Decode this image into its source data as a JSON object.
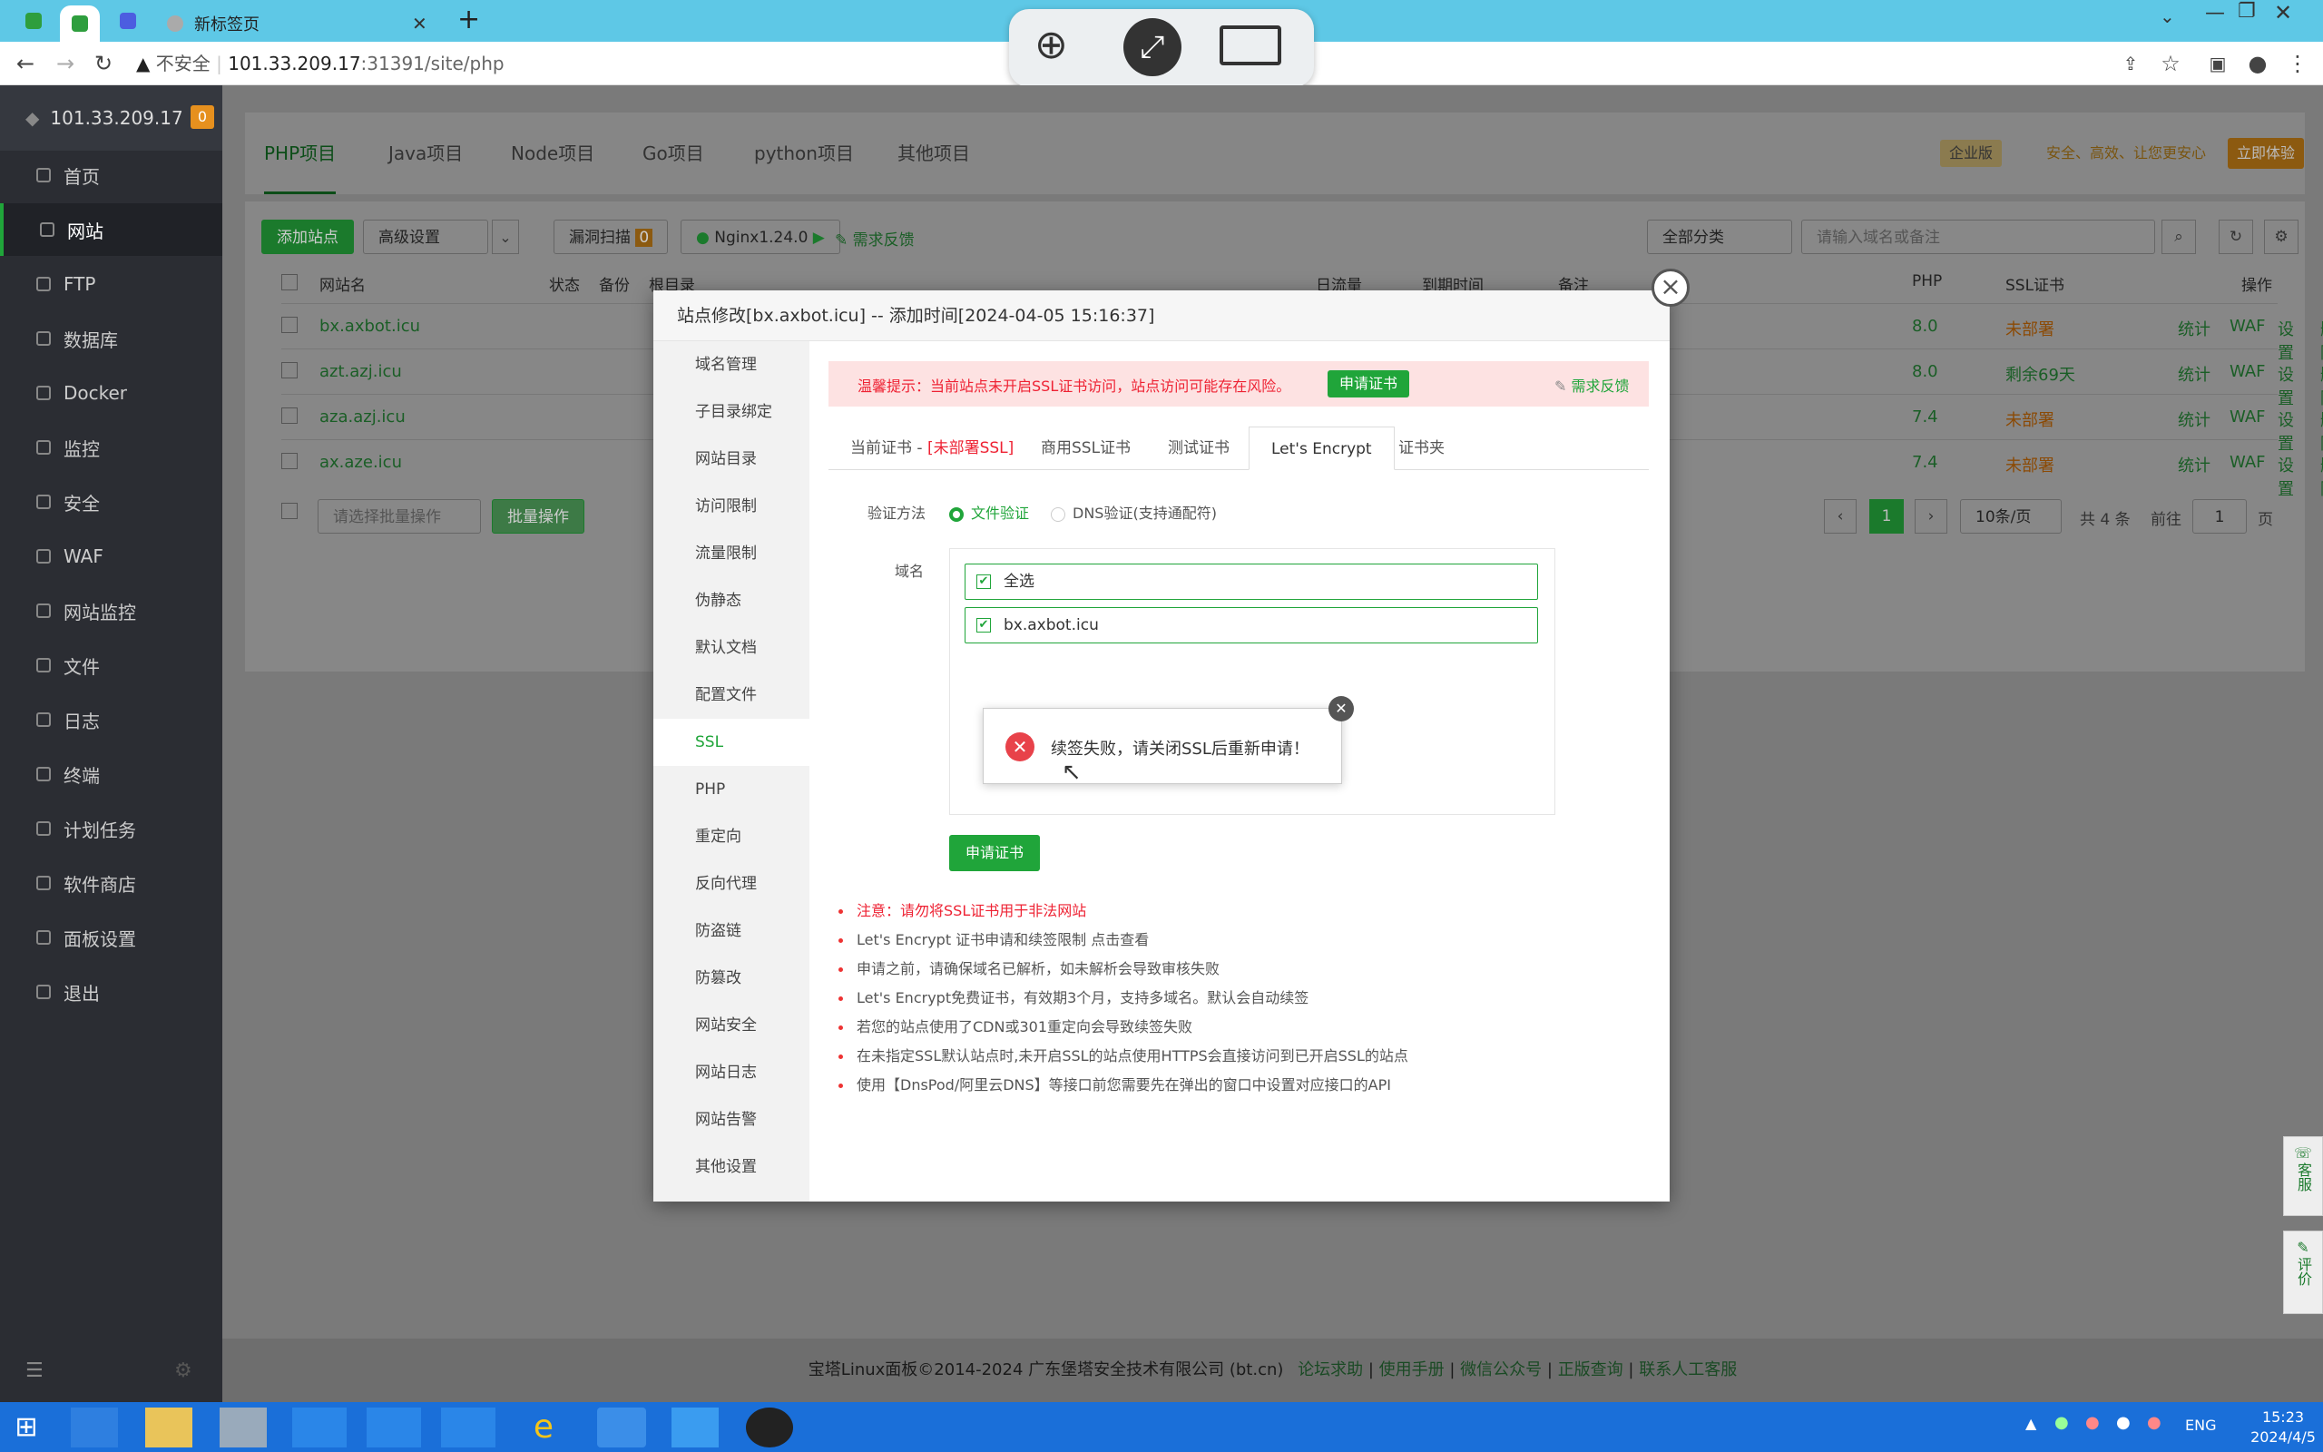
{
  "browser": {
    "tab_title": "新标签页",
    "new_tab_label": "+",
    "url_security": "不安全",
    "url_host": "101.33.209.17",
    "url_rest": ":31391/site/php"
  },
  "sidebar": {
    "host": "101.33.209.17",
    "badge": "0",
    "items": [
      {
        "label": "首页"
      },
      {
        "label": "网站"
      },
      {
        "label": "FTP"
      },
      {
        "label": "数据库"
      },
      {
        "label": "Docker"
      },
      {
        "label": "监控"
      },
      {
        "label": "安全"
      },
      {
        "label": "WAF"
      },
      {
        "label": "网站监控"
      },
      {
        "label": "文件"
      },
      {
        "label": "日志"
      },
      {
        "label": "终端"
      },
      {
        "label": "计划任务"
      },
      {
        "label": "软件商店"
      },
      {
        "label": "面板设置"
      },
      {
        "label": "退出"
      }
    ]
  },
  "topnav": {
    "tabs": [
      {
        "label": "PHP项目"
      },
      {
        "label": "Java项目"
      },
      {
        "label": "Node项目"
      },
      {
        "label": "Go项目"
      },
      {
        "label": "python项目"
      },
      {
        "label": "其他项目"
      }
    ],
    "enterprise_badge": "企业版",
    "promo": "安全、高效、让您更安心",
    "try_button": "立即体验"
  },
  "toolbar": {
    "add_site": "添加站点",
    "advanced": "高级设置",
    "scan": "漏洞扫描",
    "scan_count": "0",
    "nginx": "Nginx1.24.0",
    "feedback": "需求反馈",
    "category": "全部分类",
    "search_placeholder": "请输入域名或备注"
  },
  "table": {
    "headers": {
      "name": "网站名",
      "status": "状态",
      "backup": "备份",
      "root": "根目录",
      "traffic": "日流量",
      "expire": "到期时间",
      "note": "备注",
      "php": "PHP",
      "ssl": "SSL证书",
      "ops": "操作"
    },
    "rows": [
      {
        "name": "bx.axbot.icu",
        "php": "8.0",
        "ssl": "未部署"
      },
      {
        "name": "azt.azj.icu",
        "php": "8.0",
        "ssl": "剩余69天"
      },
      {
        "name": "aza.azj.icu",
        "php": "7.4",
        "ssl": "未部署"
      },
      {
        "name": "ax.aze.icu",
        "php": "7.4",
        "ssl": "未部署"
      }
    ],
    "row_ops": [
      "统计",
      "WAF",
      "设置",
      "删除"
    ],
    "batch_placeholder": "请选择批量操作",
    "batch_button": "批量操作",
    "page_current": "1",
    "page_size": "10条/页",
    "total": "共 4 条",
    "goto": "前往",
    "goto_value": "1",
    "page_unit": "页"
  },
  "modal": {
    "title": "站点修改[bx.axbot.icu] -- 添加时间[2024-04-05 15:16:37]",
    "menu": [
      {
        "label": "域名管理"
      },
      {
        "label": "子目录绑定"
      },
      {
        "label": "网站目录"
      },
      {
        "label": "访问限制"
      },
      {
        "label": "流量限制"
      },
      {
        "label": "伪静态"
      },
      {
        "label": "默认文档"
      },
      {
        "label": "配置文件"
      },
      {
        "label": "SSL"
      },
      {
        "label": "PHP"
      },
      {
        "label": "重定向"
      },
      {
        "label": "反向代理"
      },
      {
        "label": "防盗链"
      },
      {
        "label": "防篡改"
      },
      {
        "label": "网站安全"
      },
      {
        "label": "网站日志"
      },
      {
        "label": "网站告警"
      },
      {
        "label": "其他设置"
      }
    ],
    "alert_text": "温馨提示：当前站点未开启SSL证书访问，站点访问可能存在风险。",
    "alert_button": "申请证书",
    "alert_feedback": "需求反馈",
    "tabs": [
      {
        "label": "当前证书 - "
      },
      {
        "label": "商用SSL证书"
      },
      {
        "label": "测试证书"
      },
      {
        "label": "Let's Encrypt"
      },
      {
        "label": "证书夹"
      }
    ],
    "current_cert_tag": "[未部署SSL]",
    "verify_label": "验证方法",
    "verify_file": "文件验证",
    "verify_dns": "DNS验证(支持通配符)",
    "domain_label": "域名",
    "select_all": "全选",
    "domain": "bx.axbot.icu",
    "apply_button": "申请证书",
    "toast": "续签失败，请关闭SSL后重新申请！",
    "notes": [
      "注意：请勿将SSL证书用于非法网站",
      "Let's Encrypt 证书申请和续签限制 点击查看",
      "申请之前，请确保域名已解析，如未解析会导致审核失败",
      "Let's Encrypt免费证书，有效期3个月，支持多域名。默认会自动续签",
      "若您的站点使用了CDN或301重定向会导致续签失败",
      "在未指定SSL默认站点时,未开启SSL的站点使用HTTPS会直接访问到已开启SSL的站点",
      "使用【DnsPod/阿里云DNS】等接口前您需要先在弹出的窗口中设置对应接口的API"
    ]
  },
  "footer": {
    "copyright": "宝塔Linux面板©2014-2024 广东堡塔安全技术有限公司 (bt.cn)",
    "links": [
      "论坛求助",
      "使用手册",
      "微信公众号",
      "正版查询",
      "联系人工客服"
    ]
  },
  "float": {
    "service": "客服",
    "review": "评价"
  },
  "taskbar": {
    "lang": "ENG",
    "time": "15:23",
    "date": "2024/4/5"
  }
}
